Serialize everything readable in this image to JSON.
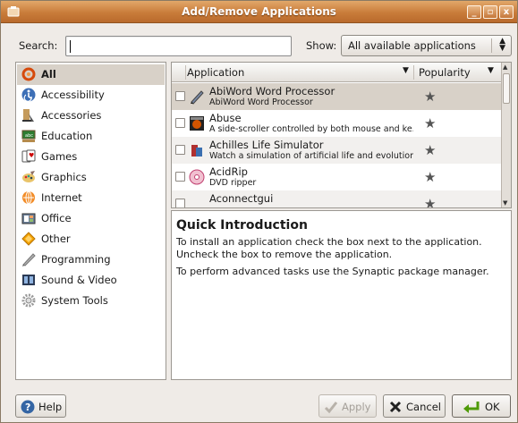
{
  "window": {
    "title": "Add/Remove Applications",
    "controls": [
      "_",
      "▫",
      "x"
    ]
  },
  "search": {
    "label": "Search:",
    "value": "",
    "placeholder": ""
  },
  "show": {
    "label": "Show:",
    "selected": "All available applications"
  },
  "categories": [
    {
      "label": "All",
      "icon": "all-icon",
      "selected": true
    },
    {
      "label": "Accessibility",
      "icon": "accessibility-icon"
    },
    {
      "label": "Accessories",
      "icon": "accessories-icon"
    },
    {
      "label": "Education",
      "icon": "education-icon"
    },
    {
      "label": "Games",
      "icon": "games-icon"
    },
    {
      "label": "Graphics",
      "icon": "graphics-icon"
    },
    {
      "label": "Internet",
      "icon": "internet-icon"
    },
    {
      "label": "Office",
      "icon": "office-icon"
    },
    {
      "label": "Other",
      "icon": "other-icon"
    },
    {
      "label": "Programming",
      "icon": "programming-icon"
    },
    {
      "label": "Sound & Video",
      "icon": "sound-video-icon"
    },
    {
      "label": "System Tools",
      "icon": "system-tools-icon"
    }
  ],
  "apps": {
    "columns": {
      "application": "Application",
      "popularity": "Popularity"
    },
    "rows": [
      {
        "name": "AbiWord Word Processor",
        "desc": "AbiWord Word Processor",
        "checked": false
      },
      {
        "name": "Abuse",
        "desc": "A side-scroller controlled by both mouse and ke...",
        "checked": false
      },
      {
        "name": "Achilles Life Simulator",
        "desc": "Watch a simulation of artificial life and evolution",
        "checked": false
      },
      {
        "name": "AcidRip",
        "desc": "DVD ripper",
        "checked": false
      },
      {
        "name": "Aconnectgui",
        "desc": "",
        "checked": false
      }
    ],
    "star": "★"
  },
  "info": {
    "heading": "Quick Introduction",
    "line1": "To install an application check the box next to the application.",
    "line2": "Uncheck the box to remove the application.",
    "line3": "To perform advanced tasks use the Synaptic package manager."
  },
  "buttons": {
    "help": "Help",
    "apply": "Apply",
    "cancel": "Cancel",
    "ok": "OK"
  },
  "colors": {
    "titlebar": "#c97c3a",
    "selection": "#d8d1c8"
  }
}
